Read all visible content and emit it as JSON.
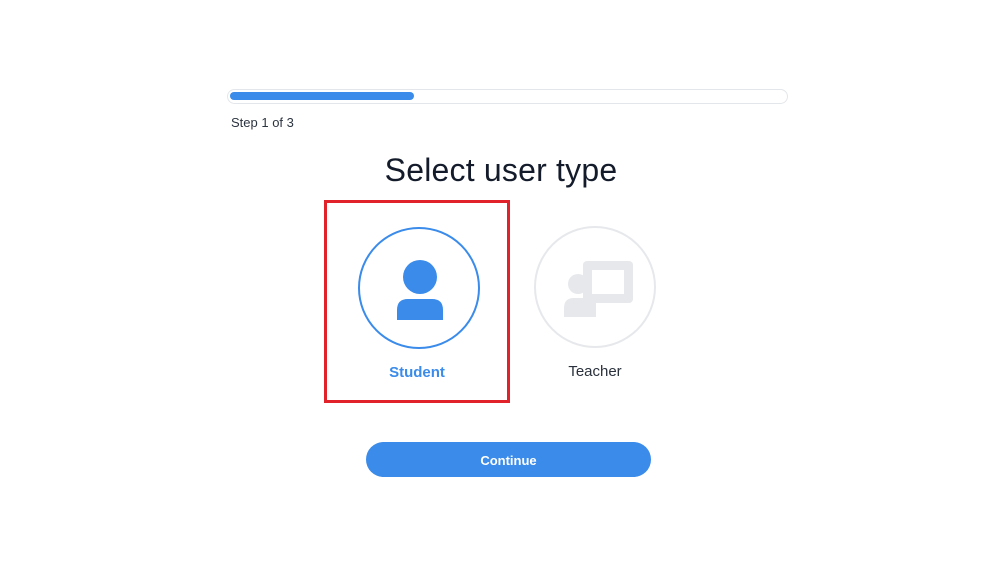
{
  "progress": {
    "step_label": "Step 1 of 3",
    "fraction": 0.333
  },
  "title": "Select user type",
  "options": [
    {
      "label": "Student",
      "icon": "person-icon",
      "selected": true
    },
    {
      "label": "Teacher",
      "icon": "teacher-presentation-icon",
      "selected": false
    }
  ],
  "continue_label": "Continue",
  "colors": {
    "accent": "#3a8bea",
    "highlight_box": "#e1222a",
    "inactive_icon": "#e6e8eb",
    "title_text": "#141c2b"
  }
}
